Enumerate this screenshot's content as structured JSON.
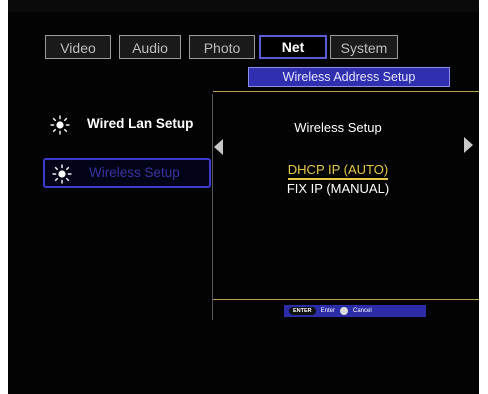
{
  "tabs": [
    {
      "label": "Video"
    },
    {
      "label": "Audio"
    },
    {
      "label": "Photo"
    },
    {
      "label": "Net",
      "active": true
    },
    {
      "label": "System"
    }
  ],
  "header": {
    "title": "Wireless Address Setup"
  },
  "sidebar": {
    "items": [
      {
        "label": "Wired Lan Setup",
        "icon": "sun-icon"
      },
      {
        "label": "Wireless Setup",
        "icon": "sun-icon",
        "selected": true
      }
    ]
  },
  "panel": {
    "title": "Wireless Setup",
    "options": [
      {
        "label": "DHCP IP (AUTO)",
        "selected": true
      },
      {
        "label": "FIX IP (MANUAL)"
      }
    ]
  },
  "footer": {
    "enter_key": "ENTER",
    "enter_label": "Enter",
    "cancel_label": "Cancel"
  },
  "colors": {
    "accent": "#2f2fb0",
    "highlight": "#e7c94a",
    "background": "#030303"
  }
}
